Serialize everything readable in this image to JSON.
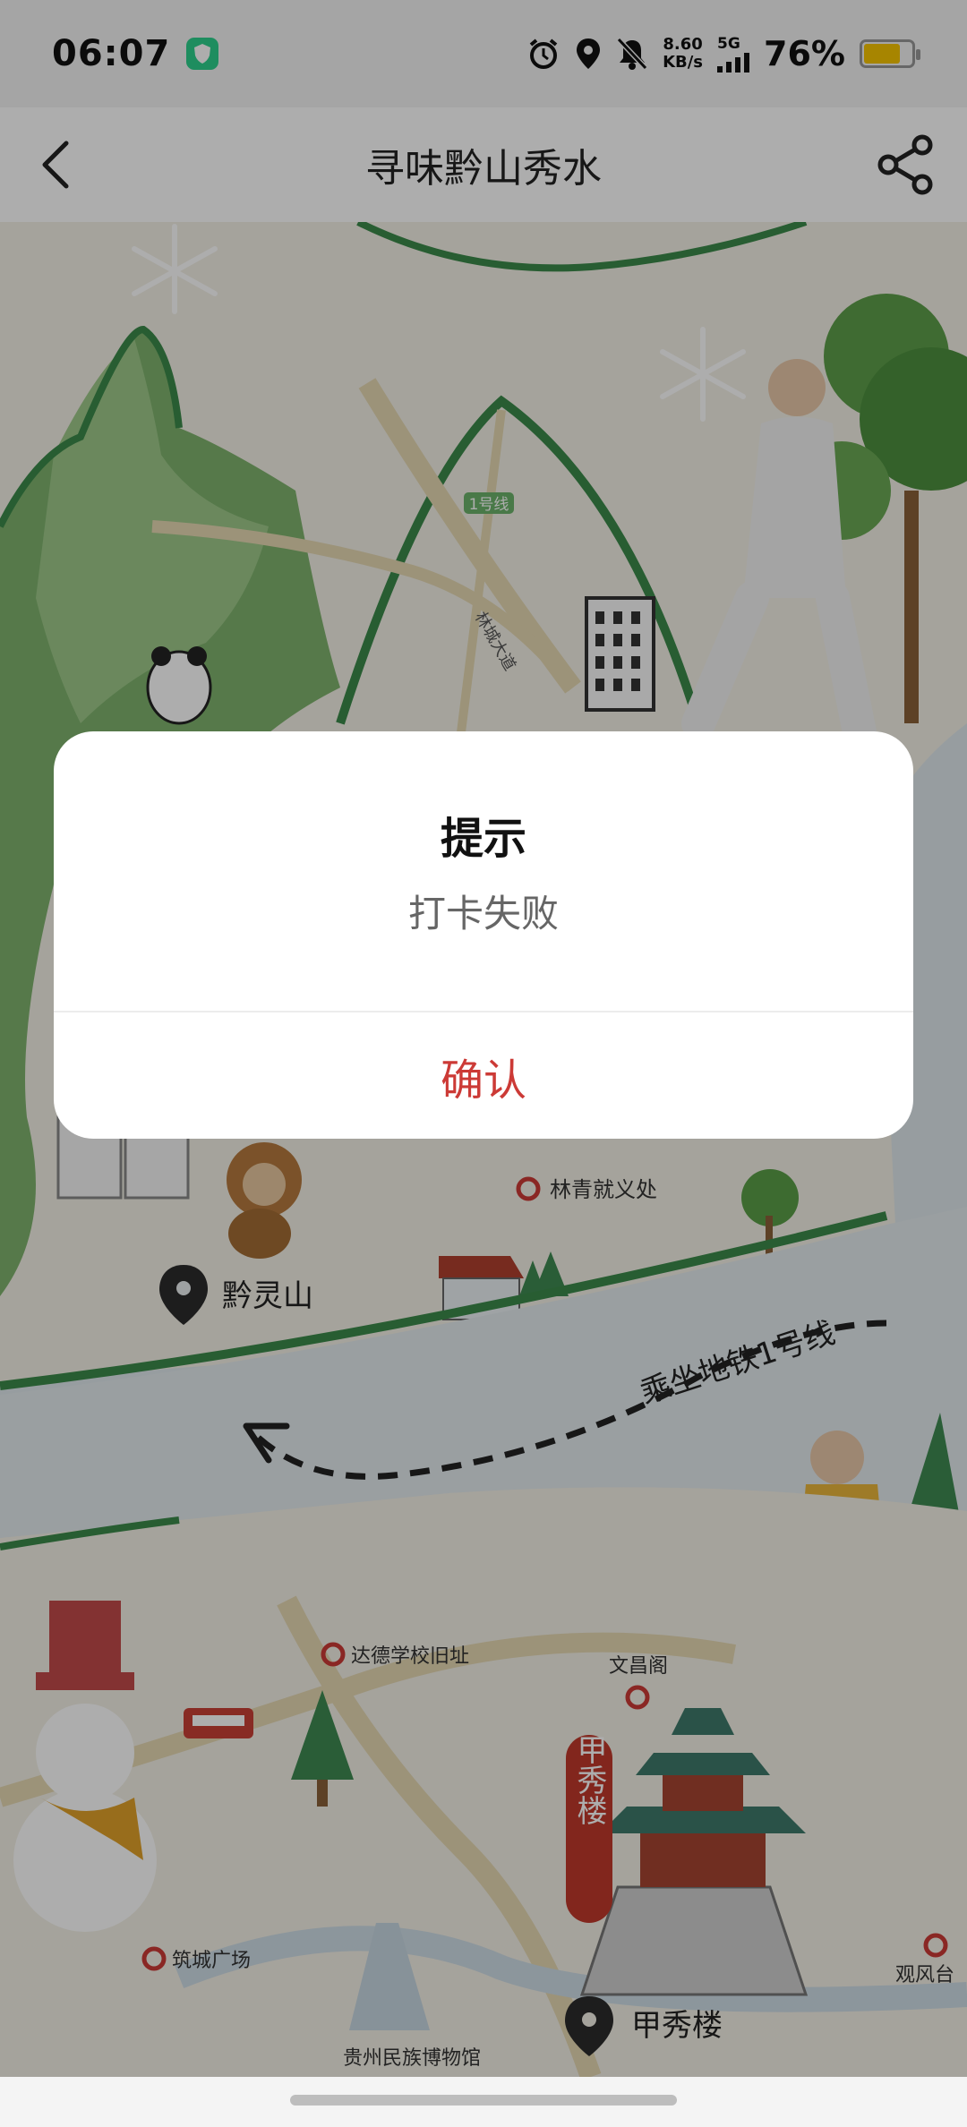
{
  "status_bar": {
    "time": "06:07",
    "net_speed_value": "8.60",
    "net_speed_unit": "KB/s",
    "network_type": "5G",
    "battery_percent": "76%",
    "battery_level": 0.76,
    "icons": [
      "shield-app-icon",
      "alarm-icon",
      "location-icon",
      "mute-bell-icon",
      "signal-icon",
      "battery-icon"
    ]
  },
  "nav": {
    "title": "寻味黔山秀水",
    "back_icon": "back-arrow-icon",
    "share_icon": "share-icon"
  },
  "map": {
    "route_label": "乘坐地铁1号线",
    "metro_badge": "1号线",
    "road_label": "林城大道",
    "places": [
      {
        "name": "林青就义处",
        "type": "poi"
      },
      {
        "name": "黔灵山",
        "type": "landmark"
      },
      {
        "name": "达德学校旧址",
        "type": "poi"
      },
      {
        "name": "文昌阁",
        "type": "poi"
      },
      {
        "name": "筑城广场",
        "type": "poi"
      },
      {
        "name": "观风台",
        "type": "poi"
      },
      {
        "name": "贵州民族博物馆",
        "type": "poi"
      },
      {
        "name": "甲秀楼",
        "type": "landmark"
      }
    ],
    "banner_text": "甲秀楼"
  },
  "dialog": {
    "title": "提示",
    "message": "打卡失败",
    "confirm_label": "确认"
  },
  "colors": {
    "accent": "#cc3a36",
    "map_land": "#f3f0e6",
    "map_water": "#d6e4ea",
    "map_green": "#3b8a4a",
    "overlay": "rgba(0,0,0,0.32)"
  }
}
